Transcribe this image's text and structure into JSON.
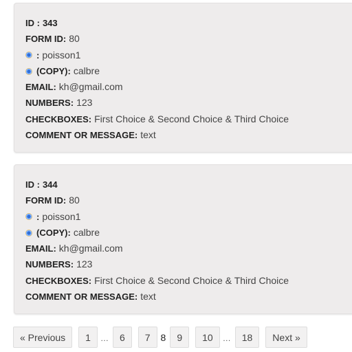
{
  "entries": [
    {
      "id_label": "ID :",
      "id_value": "343",
      "form_id_label": "FORM ID:",
      "form_id_value": "80",
      "field1_sep": ":",
      "field1_value": "poisson1",
      "field2_label": "(COPY):",
      "field2_value": "calbre",
      "email_label": "EMAIL:",
      "email_value": "kh@gmail.com",
      "numbers_label": "NUMBERS:",
      "numbers_value": "123",
      "checkboxes_label": "CHECKBOXES:",
      "checkboxes_value": "First Choice & Second Choice & Third Choice",
      "comment_label": "COMMENT OR MESSAGE:",
      "comment_value": "text"
    },
    {
      "id_label": "ID :",
      "id_value": "344",
      "form_id_label": "FORM ID:",
      "form_id_value": "80",
      "field1_sep": ":",
      "field1_value": "poisson1",
      "field2_label": "(COPY):",
      "field2_value": "calbre",
      "email_label": "EMAIL:",
      "email_value": "kh@gmail.com",
      "numbers_label": "NUMBERS:",
      "numbers_value": "123",
      "checkboxes_label": "CHECKBOXES:",
      "checkboxes_value": "First Choice & Second Choice & Third Choice",
      "comment_label": "COMMENT OR MESSAGE:",
      "comment_value": "text"
    }
  ],
  "icons": {
    "field_icon": "field-logo-icon"
  },
  "pagination": {
    "previous": "« Previous",
    "p1": "1",
    "dots1": "…",
    "p6": "6",
    "p7": "7",
    "current": "8",
    "p9": "9",
    "p10": "10",
    "dots2": "…",
    "p18": "18",
    "next": "Next »"
  }
}
